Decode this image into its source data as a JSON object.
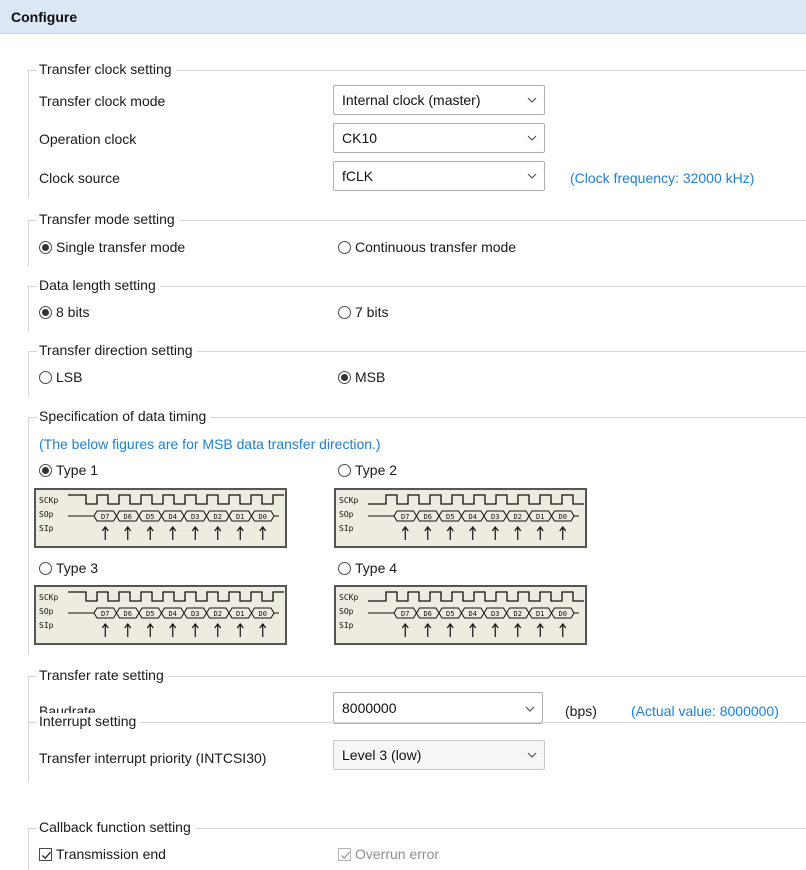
{
  "header": {
    "title": "Configure"
  },
  "transfer_clock": {
    "legend": "Transfer clock setting",
    "mode_label": "Transfer clock mode",
    "mode_value": "Internal clock (master)",
    "op_clock_label": "Operation clock",
    "op_clock_value": "CK10",
    "source_label": "Clock source",
    "source_value": "fCLK",
    "frequency_note": "(Clock frequency: 32000 kHz)"
  },
  "transfer_mode": {
    "legend": "Transfer mode setting",
    "single": "Single transfer mode",
    "continuous": "Continuous transfer mode",
    "selected": "single"
  },
  "data_length": {
    "legend": "Data length setting",
    "bits8": "8 bits",
    "bits7": "7 bits",
    "selected": "8"
  },
  "direction": {
    "legend": "Transfer direction setting",
    "lsb": "LSB",
    "msb": "MSB",
    "selected": "MSB"
  },
  "timing": {
    "legend": "Specification of data timing",
    "note": "(The below figures are for MSB data transfer direction.)",
    "types": [
      "Type 1",
      "Type 2",
      "Type 3",
      "Type 4"
    ],
    "selected": "Type 1",
    "signals": [
      "SCKp",
      "SOp",
      "SIp"
    ],
    "bits": [
      "D7",
      "D6",
      "D5",
      "D4",
      "D3",
      "D2",
      "D1",
      "D0"
    ]
  },
  "rate": {
    "legend": "Transfer rate setting",
    "baud_label": "Baudrate",
    "baud_value": "8000000",
    "unit": "(bps)",
    "actual_note": "(Actual value: 8000000)"
  },
  "interrupt": {
    "legend": "Interrupt setting",
    "priority_label": "Transfer interrupt priority (INTCSI30)",
    "priority_value": "Level 3 (low)"
  },
  "callback": {
    "legend": "Callback function setting",
    "transmission_end": "Transmission end",
    "transmission_end_checked": true,
    "overrun": "Overrun error",
    "overrun_checked": true,
    "overrun_disabled": true
  }
}
